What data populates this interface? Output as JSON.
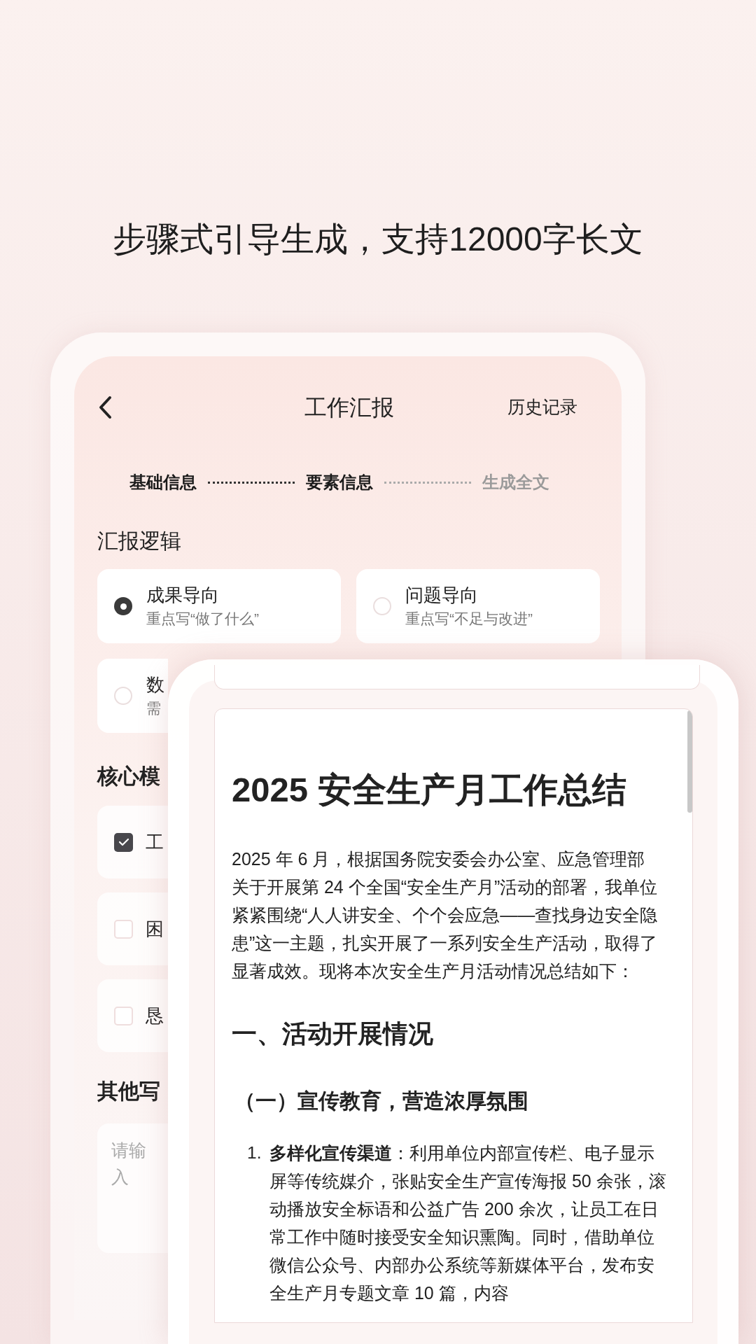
{
  "headline": "步骤式引导生成，支持12000字长文",
  "report_screen": {
    "title": "工作汇报",
    "history_link": "历史记录",
    "steps": [
      {
        "label": "基础信息",
        "completed": true
      },
      {
        "label": "要素信息",
        "completed": true
      },
      {
        "label": "生成全文",
        "completed": false
      }
    ],
    "logic": {
      "heading": "汇报逻辑",
      "options": [
        {
          "title": "成果导向",
          "hint": "重点写“做了什么”",
          "selected": true
        },
        {
          "title": "问题导向",
          "hint": "重点写“不足与改进”",
          "selected": false
        },
        {
          "title": "数",
          "hint": "需",
          "selected": false
        }
      ]
    },
    "modules": {
      "heading": "核心模",
      "items": [
        {
          "label": "工",
          "checked": true
        },
        {
          "label": "困",
          "checked": false
        },
        {
          "label": "恳",
          "checked": false
        }
      ]
    },
    "other": {
      "heading": "其他写",
      "placeholder": "请输入"
    }
  },
  "document_screen": {
    "title": "2025 安全生产月工作总结",
    "intro": "2025 年 6 月，根据国务院安委会办公室、应急管理部关于开展第 24 个全国“安全生产月”活动的部署，我单位紧紧围绕“人人讲安全、个个会应急——查找身边安全隐患”这一主题，扎实开展了一系列安全生产活动，取得了显著成效。现将本次安全生产月活动情况总结如下：",
    "section_heading": "一、活动开展情况",
    "subsection_heading": "（一）宣传教育，营造浓厚氛围",
    "list": [
      {
        "number": "1.",
        "text": "**多样化宣传渠道**：利用单位内部宣传栏、电子显示屏等传统媒介，张贴安全生产宣传海报 50 余张，滚动播放安全标语和公益广告 200 余次，让员工在日常工作中随时接受安全知识熏陶。同时，借助单位微信公众号、内部办公系统等新媒体平台，发布安全生产月专题文章 10 篇，内容"
      }
    ]
  }
}
